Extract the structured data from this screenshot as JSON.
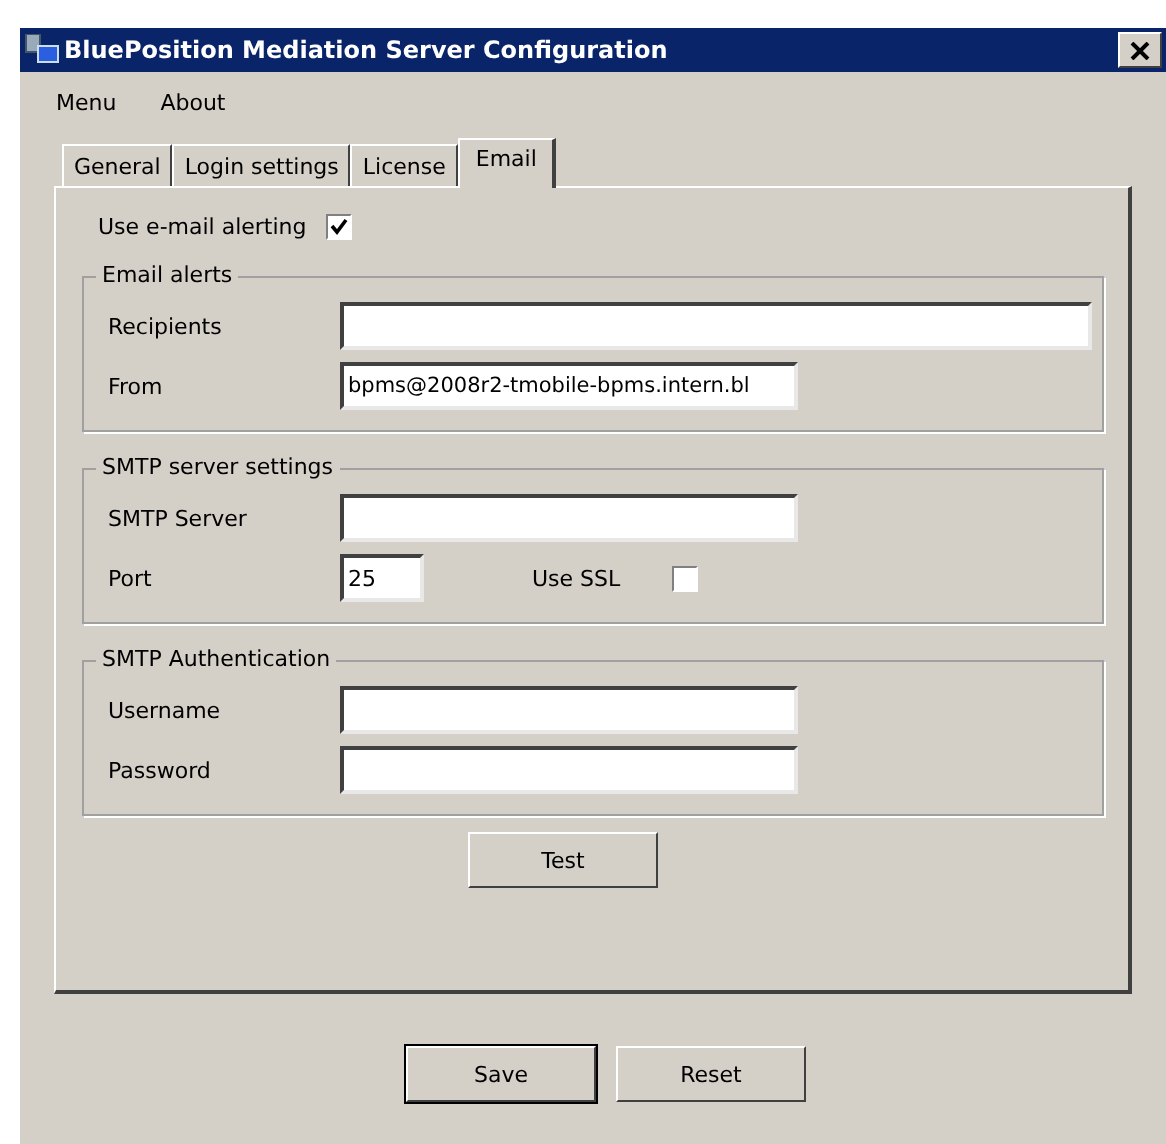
{
  "window": {
    "title": "BluePosition Mediation Server Configuration"
  },
  "menu": [
    "Menu",
    "About"
  ],
  "tabs": [
    {
      "label": "General",
      "selected": false
    },
    {
      "label": "Login settings",
      "selected": false
    },
    {
      "label": "License",
      "selected": false
    },
    {
      "label": "Email",
      "selected": true
    }
  ],
  "use_email_alerting": {
    "label": "Use e-mail alerting",
    "checked": true
  },
  "groups": [
    {
      "title": "Email alerts",
      "rows": [
        [
          {
            "kind": "longtext",
            "label": "Recipients"
          }
        ],
        [
          {
            "kind": "text",
            "label": "From",
            "value": "bpms@2008r2-tmobile-bpms.intern.bl"
          }
        ]
      ]
    },
    {
      "title": "SMTP server settings",
      "rows": [
        [
          {
            "kind": "text",
            "label": "SMTP Server"
          }
        ],
        [
          {
            "kind": "number",
            "label": "Port",
            "value": "25"
          },
          {
            "kind": "checkbox",
            "label": "Use SSL",
            "checked": false
          }
        ]
      ]
    },
    {
      "title": "SMTP Authentication",
      "rows": [
        [
          {
            "kind": "text",
            "label": "Username"
          }
        ],
        [
          {
            "kind": "text",
            "label": "Password"
          }
        ]
      ]
    }
  ],
  "test_button": "Test",
  "buttons": [
    "Save",
    "Reset"
  ]
}
